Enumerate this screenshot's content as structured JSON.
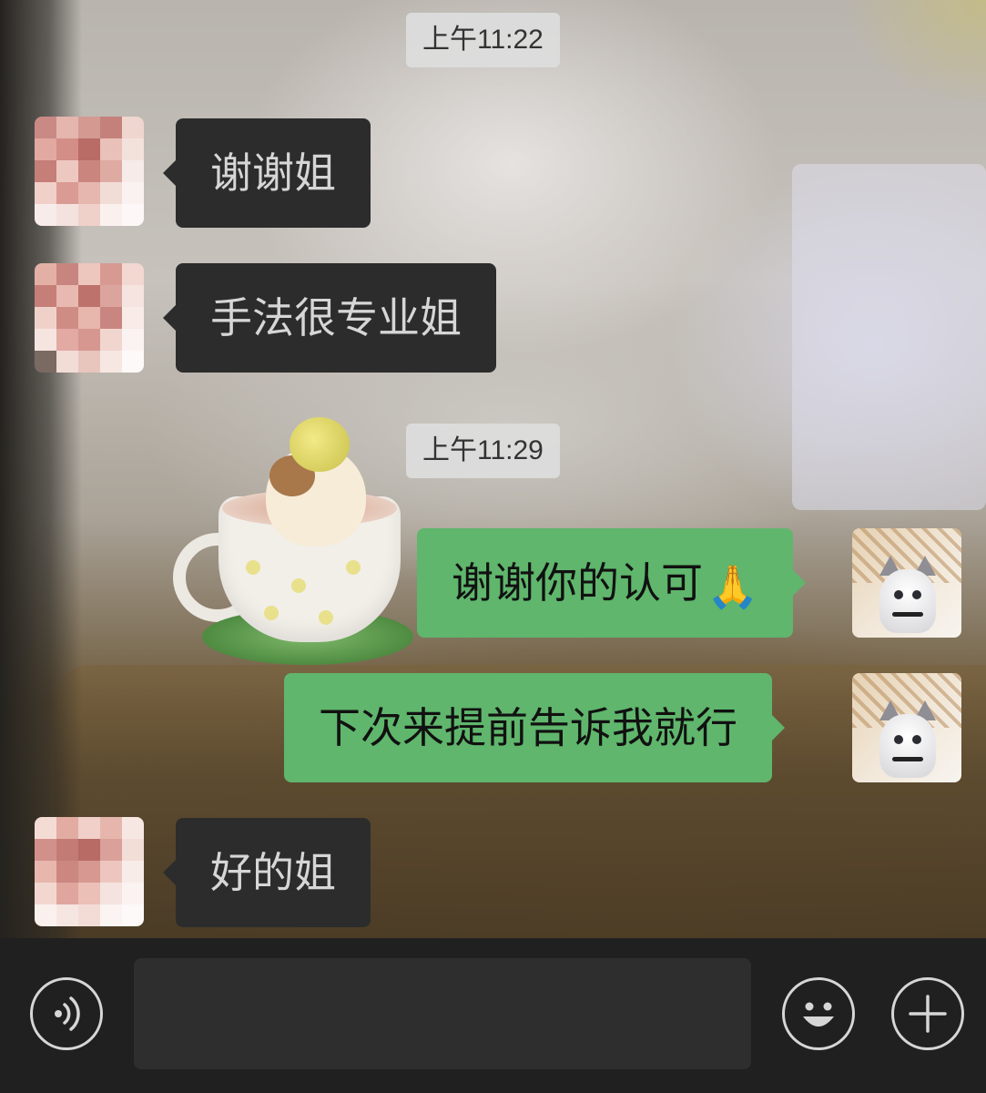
{
  "chat": {
    "timestamps": [
      "上午11:22",
      "上午11:29"
    ],
    "messages": [
      {
        "side": "in",
        "text": "谢谢姐"
      },
      {
        "side": "in",
        "text": "手法很专业姐"
      },
      {
        "side": "out",
        "text": "谢谢你的认可",
        "emoji": "🙏"
      },
      {
        "side": "out",
        "text": "下次来提前告诉我就行"
      },
      {
        "side": "in",
        "text": "好的姐"
      }
    ]
  },
  "input_bar": {
    "message_input_value": "",
    "voice_icon": "voice-wave-icon",
    "emoji_icon": "smiley-face-icon",
    "plus_icon": "plus-icon"
  },
  "colors": {
    "incoming_bubble": "#2c2c2c",
    "outgoing_bubble": "#5fb66c",
    "timestamp_bg": "#dddddd",
    "input_bar_bg": "#202020"
  }
}
